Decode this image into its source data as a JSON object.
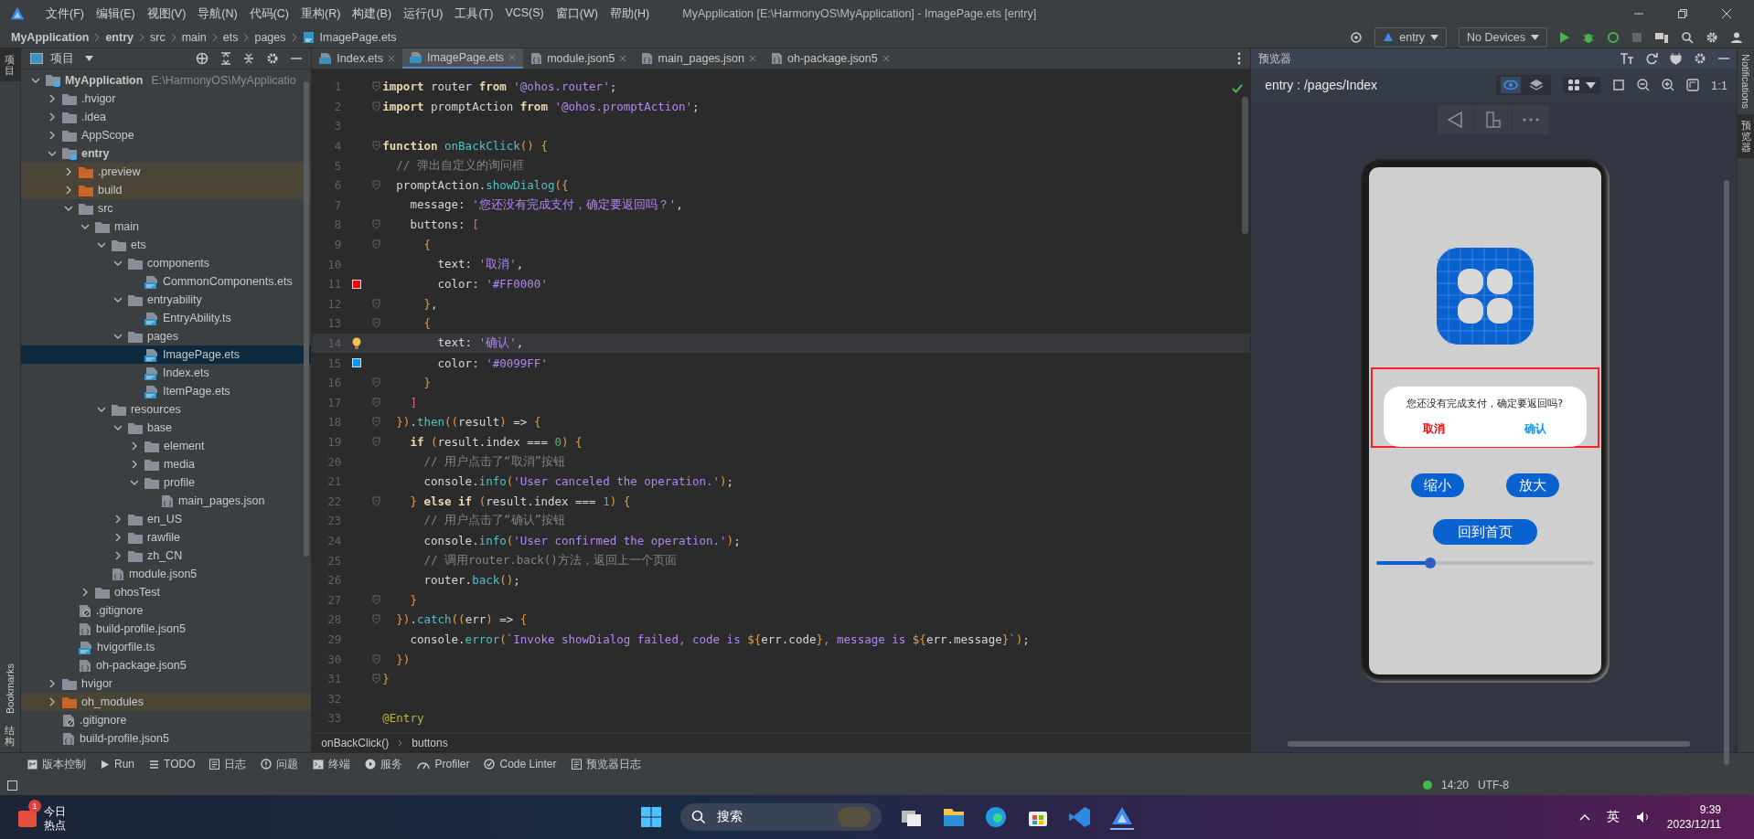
{
  "window": {
    "title": "MyApplication [E:\\HarmonyOS\\MyApplication] - ImagePage.ets [entry]",
    "menu": [
      "文件(F)",
      "编辑(E)",
      "视图(V)",
      "导航(N)",
      "代码(C)",
      "重构(R)",
      "构建(B)",
      "运行(U)",
      "工具(T)",
      "VCS(S)",
      "窗口(W)",
      "帮助(H)"
    ]
  },
  "navbar": {
    "breadcrumb": [
      "MyApplication",
      "entry",
      "src",
      "main",
      "ets",
      "pages",
      "ImagePage.ets"
    ],
    "run_config": "entry",
    "device": "No Devices"
  },
  "left_strip": [
    {
      "label": "项目",
      "selected": true
    },
    {
      "label": "Bookmarks",
      "selected": false
    },
    {
      "label": "结构",
      "selected": false
    }
  ],
  "project": {
    "title": "项目",
    "tree": [
      {
        "label": "MyApplication",
        "kind": "module",
        "hint": "E:\\HarmonyOS\\MyApplicatio",
        "expanded": true,
        "selected": false,
        "excluded": false,
        "children": [
          {
            "label": ".hvigor",
            "kind": "folder",
            "expanded": false,
            "selected": false,
            "excluded": false
          },
          {
            "label": ".idea",
            "kind": "folder",
            "expanded": false,
            "selected": false,
            "excluded": false
          },
          {
            "label": "AppScope",
            "kind": "folder",
            "expanded": false,
            "selected": false,
            "excluded": false
          },
          {
            "label": "entry",
            "kind": "module",
            "expanded": true,
            "selected": false,
            "excluded": false,
            "children": [
              {
                "label": ".preview",
                "kind": "folder",
                "expanded": false,
                "selected": false,
                "excluded": true
              },
              {
                "label": "build",
                "kind": "folder",
                "expanded": false,
                "selected": false,
                "excluded": true
              },
              {
                "label": "src",
                "kind": "folder",
                "expanded": true,
                "selected": false,
                "excluded": false,
                "children": [
                  {
                    "label": "main",
                    "kind": "folder",
                    "expanded": true,
                    "selected": false,
                    "excluded": false,
                    "children": [
                      {
                        "label": "ets",
                        "kind": "folder",
                        "expanded": true,
                        "selected": false,
                        "excluded": false,
                        "children": [
                          {
                            "label": "components",
                            "kind": "folder",
                            "expanded": true,
                            "selected": false,
                            "excluded": false,
                            "children": [
                              {
                                "label": "CommonComponents.ets",
                                "kind": "ets",
                                "selected": false,
                                "excluded": false
                              }
                            ]
                          },
                          {
                            "label": "entryability",
                            "kind": "folder",
                            "expanded": true,
                            "selected": false,
                            "excluded": false,
                            "children": [
                              {
                                "label": "EntryAbility.ts",
                                "kind": "ts",
                                "selected": false,
                                "excluded": false
                              }
                            ]
                          },
                          {
                            "label": "pages",
                            "kind": "folder",
                            "expanded": true,
                            "selected": false,
                            "excluded": false,
                            "children": [
                              {
                                "label": "ImagePage.ets",
                                "kind": "ets",
                                "selected": true,
                                "excluded": false
                              },
                              {
                                "label": "Index.ets",
                                "kind": "ets",
                                "selected": false,
                                "excluded": false
                              },
                              {
                                "label": "ItemPage.ets",
                                "kind": "ets",
                                "selected": false,
                                "excluded": false
                              }
                            ]
                          }
                        ]
                      },
                      {
                        "label": "resources",
                        "kind": "folder",
                        "expanded": true,
                        "selected": false,
                        "excluded": false,
                        "children": [
                          {
                            "label": "base",
                            "kind": "folder",
                            "expanded": true,
                            "selected": false,
                            "excluded": false,
                            "children": [
                              {
                                "label": "element",
                                "kind": "folder",
                                "expanded": false,
                                "selected": false,
                                "excluded": false
                              },
                              {
                                "label": "media",
                                "kind": "folder",
                                "expanded": false,
                                "selected": false,
                                "excluded": false
                              },
                              {
                                "label": "profile",
                                "kind": "folder",
                                "expanded": true,
                                "selected": false,
                                "excluded": false,
                                "children": [
                                  {
                                    "label": "main_pages.json",
                                    "kind": "json",
                                    "selected": false,
                                    "excluded": false
                                  }
                                ]
                              }
                            ]
                          },
                          {
                            "label": "en_US",
                            "kind": "folder",
                            "expanded": false,
                            "selected": false,
                            "excluded": false
                          },
                          {
                            "label": "rawfile",
                            "kind": "folder",
                            "expanded": false,
                            "selected": false,
                            "excluded": false
                          },
                          {
                            "label": "zh_CN",
                            "kind": "folder",
                            "expanded": false,
                            "selected": false,
                            "excluded": false
                          }
                        ]
                      },
                      {
                        "label": "module.json5",
                        "kind": "json",
                        "selected": false,
                        "excluded": false
                      }
                    ]
                  },
                  {
                    "label": "ohosTest",
                    "kind": "folder",
                    "expanded": false,
                    "selected": false,
                    "excluded": false
                  }
                ]
              },
              {
                "label": ".gitignore",
                "kind": "ignore",
                "selected": false,
                "excluded": false
              },
              {
                "label": "build-profile.json5",
                "kind": "json",
                "selected": false,
                "excluded": false
              },
              {
                "label": "hvigorfile.ts",
                "kind": "ts",
                "selected": false,
                "excluded": false
              },
              {
                "label": "oh-package.json5",
                "kind": "json",
                "selected": false,
                "excluded": false
              }
            ]
          },
          {
            "label": "hvigor",
            "kind": "folder",
            "expanded": false,
            "selected": false,
            "excluded": false
          },
          {
            "label": "oh_modules",
            "kind": "folder",
            "expanded": false,
            "selected": false,
            "excluded": true
          },
          {
            "label": ".gitignore",
            "kind": "ignore",
            "selected": false,
            "excluded": false
          },
          {
            "label": "build-profile.json5",
            "kind": "json",
            "selected": false,
            "excluded": false
          }
        ]
      }
    ]
  },
  "editor": {
    "tabs": [
      {
        "label": "Index.ets",
        "kind": "ets",
        "selected": false
      },
      {
        "label": "ImagePage.ets",
        "kind": "ets",
        "selected": true
      },
      {
        "label": "module.json5",
        "kind": "json",
        "selected": false
      },
      {
        "label": "main_pages.json",
        "kind": "json",
        "selected": false
      },
      {
        "label": "oh-package.json5",
        "kind": "json",
        "selected": false
      }
    ],
    "lines": [
      {
        "number": "1",
        "fold": true,
        "segments": [
          {
            "kind": "keyword",
            "text": "import"
          },
          {
            "kind": "plain",
            "text": " router "
          },
          {
            "kind": "keyword",
            "text": "from"
          },
          {
            "kind": "string",
            "text": " '@ohos.router'"
          },
          {
            "kind": "plain",
            "text": ";"
          }
        ]
      },
      {
        "number": "2",
        "fold": true,
        "segments": [
          {
            "kind": "keyword",
            "text": "import"
          },
          {
            "kind": "plain",
            "text": " promptAction "
          },
          {
            "kind": "keyword",
            "text": "from"
          },
          {
            "kind": "string",
            "text": " '@ohos.promptAction'"
          },
          {
            "kind": "plain",
            "text": ";"
          }
        ]
      },
      {
        "number": "3",
        "fold": false
      },
      {
        "number": "4",
        "fold": true,
        "segments": [
          {
            "kind": "keyword",
            "text": "function"
          },
          {
            "kind": "function",
            "text": " onBackClick"
          },
          {
            "kind": "brace",
            "text": "() {"
          }
        ]
      },
      {
        "number": "5",
        "fold": false,
        "segments": [
          {
            "kind": "comment",
            "text": "  // 弹出自定义的询问框"
          }
        ]
      },
      {
        "number": "6",
        "fold": true,
        "segments": [
          {
            "kind": "plain",
            "text": "  promptAction."
          },
          {
            "kind": "function",
            "text": "showDialog"
          },
          {
            "kind": "brace",
            "text": "({"
          }
        ]
      },
      {
        "number": "7",
        "fold": false,
        "segments": [
          {
            "kind": "plain",
            "text": "    message: "
          },
          {
            "kind": "string",
            "text": "'您还没有完成支付，确定要返回吗？'"
          },
          {
            "kind": "plain",
            "text": ","
          }
        ]
      },
      {
        "number": "8",
        "fold": true,
        "segments": [
          {
            "kind": "plain",
            "text": "    buttons: "
          },
          {
            "kind": "bracket",
            "text": "["
          }
        ]
      },
      {
        "number": "9",
        "fold": true,
        "segments": [
          {
            "kind": "brace",
            "text": "      {"
          }
        ]
      },
      {
        "number": "10",
        "fold": false,
        "segments": [
          {
            "kind": "plain",
            "text": "        text: "
          },
          {
            "kind": "string",
            "text": "'取消'"
          },
          {
            "kind": "plain",
            "text": ","
          }
        ]
      },
      {
        "number": "11",
        "fold": false,
        "color": "#ff0000",
        "segments": [
          {
            "kind": "plain",
            "text": "        color: "
          },
          {
            "kind": "string",
            "text": "'#FF0000'"
          }
        ]
      },
      {
        "number": "12",
        "fold": true,
        "segments": [
          {
            "kind": "brace",
            "text": "      }"
          },
          {
            "kind": "plain",
            "text": ","
          }
        ]
      },
      {
        "number": "13",
        "fold": true,
        "segments": [
          {
            "kind": "brace",
            "text": "      {"
          }
        ]
      },
      {
        "number": "14",
        "fold": false,
        "current": true,
        "bulb": true,
        "segments": [
          {
            "kind": "plain",
            "text": "        text: "
          },
          {
            "kind": "string",
            "text": "'确认'"
          },
          {
            "kind": "plain",
            "text": ","
          }
        ]
      },
      {
        "number": "15",
        "fold": false,
        "color": "#0099ff",
        "segments": [
          {
            "kind": "plain",
            "text": "        color: "
          },
          {
            "kind": "string",
            "text": "'#0099FF'"
          }
        ]
      },
      {
        "number": "16",
        "fold": true,
        "segments": [
          {
            "kind": "brace",
            "text": "      }"
          }
        ]
      },
      {
        "number": "17",
        "fold": true,
        "segments": [
          {
            "kind": "bracket",
            "text": "    ]"
          }
        ]
      },
      {
        "number": "18",
        "fold": true,
        "segments": [
          {
            "kind": "brace",
            "text": "  })"
          },
          {
            "kind": "plain",
            "text": "."
          },
          {
            "kind": "function",
            "text": "then"
          },
          {
            "kind": "brace",
            "text": "(("
          },
          {
            "kind": "plain",
            "text": "result"
          },
          {
            "kind": "brace",
            "text": ")"
          },
          {
            "kind": "plain",
            "text": " => "
          },
          {
            "kind": "brace",
            "text": "{"
          }
        ]
      },
      {
        "number": "19",
        "fold": true,
        "segments": [
          {
            "kind": "keyword",
            "text": "    if"
          },
          {
            "kind": "brace",
            "text": " ("
          },
          {
            "kind": "plain",
            "text": "result.index === "
          },
          {
            "kind": "number",
            "text": "0"
          },
          {
            "kind": "brace",
            "text": ") {"
          }
        ]
      },
      {
        "number": "20",
        "fold": false,
        "segments": [
          {
            "kind": "comment",
            "text": "      // 用户点击了“取消”按钮"
          }
        ]
      },
      {
        "number": "21",
        "fold": false,
        "segments": [
          {
            "kind": "plain",
            "text": "      console."
          },
          {
            "kind": "function",
            "text": "info"
          },
          {
            "kind": "brace",
            "text": "("
          },
          {
            "kind": "string",
            "text": "'User canceled the operation.'"
          },
          {
            "kind": "brace",
            "text": ")"
          },
          {
            "kind": "plain",
            "text": ";"
          }
        ]
      },
      {
        "number": "22",
        "fold": true,
        "segments": [
          {
            "kind": "brace",
            "text": "    }"
          },
          {
            "kind": "keyword",
            "text": " else if"
          },
          {
            "kind": "brace",
            "text": " ("
          },
          {
            "kind": "plain",
            "text": "result.index === "
          },
          {
            "kind": "number",
            "text": "1"
          },
          {
            "kind": "brace",
            "text": ") {"
          }
        ]
      },
      {
        "number": "23",
        "fold": false,
        "segments": [
          {
            "kind": "comment",
            "text": "      // 用户点击了“确认”按钮"
          }
        ]
      },
      {
        "number": "24",
        "fold": false,
        "segments": [
          {
            "kind": "plain",
            "text": "      console."
          },
          {
            "kind": "function",
            "text": "info"
          },
          {
            "kind": "brace",
            "text": "("
          },
          {
            "kind": "string",
            "text": "'User confirmed the operation.'"
          },
          {
            "kind": "brace",
            "text": ")"
          },
          {
            "kind": "plain",
            "text": ";"
          }
        ]
      },
      {
        "number": "25",
        "fold": false,
        "segments": [
          {
            "kind": "comment",
            "text": "      // 调用router.back()方法，返回上一个页面"
          }
        ]
      },
      {
        "number": "26",
        "fold": false,
        "segments": [
          {
            "kind": "plain",
            "text": "      router."
          },
          {
            "kind": "function",
            "text": "back"
          },
          {
            "kind": "brace",
            "text": "()"
          },
          {
            "kind": "plain",
            "text": ";"
          }
        ]
      },
      {
        "number": "27",
        "fold": true,
        "segments": [
          {
            "kind": "brace",
            "text": "    }"
          }
        ]
      },
      {
        "number": "28",
        "fold": true,
        "segments": [
          {
            "kind": "brace",
            "text": "  })"
          },
          {
            "kind": "plain",
            "text": "."
          },
          {
            "kind": "function",
            "text": "catch"
          },
          {
            "kind": "brace",
            "text": "(("
          },
          {
            "kind": "plain",
            "text": "err"
          },
          {
            "kind": "brace",
            "text": ")"
          },
          {
            "kind": "plain",
            "text": " => "
          },
          {
            "kind": "brace",
            "text": "{"
          }
        ]
      },
      {
        "number": "29",
        "fold": false,
        "segments": [
          {
            "kind": "plain",
            "text": "    console."
          },
          {
            "kind": "function",
            "text": "error"
          },
          {
            "kind": "brace",
            "text": "("
          },
          {
            "kind": "string",
            "text": "`Invoke showDialog failed, code is "
          },
          {
            "kind": "brace",
            "text": "${"
          },
          {
            "kind": "plain",
            "text": "err.code"
          },
          {
            "kind": "brace",
            "text": "}"
          },
          {
            "kind": "string",
            "text": ", message is "
          },
          {
            "kind": "brace",
            "text": "${"
          },
          {
            "kind": "plain",
            "text": "err.message"
          },
          {
            "kind": "brace",
            "text": "}"
          },
          {
            "kind": "string",
            "text": "`"
          },
          {
            "kind": "brace",
            "text": ")"
          },
          {
            "kind": "plain",
            "text": ";"
          }
        ]
      },
      {
        "number": "30",
        "fold": true,
        "segments": [
          {
            "kind": "brace",
            "text": "  })"
          }
        ]
      },
      {
        "number": "31",
        "fold": true,
        "segments": [
          {
            "kind": "brace",
            "text": "}"
          }
        ]
      },
      {
        "number": "32",
        "fold": false
      },
      {
        "number": "33",
        "fold": false,
        "segments": [
          {
            "kind": "annotation",
            "text": "@Entry"
          }
        ]
      }
    ],
    "breadcrumb": [
      "onBackClick()",
      "buttons"
    ]
  },
  "preview": {
    "title": "预览器",
    "route": "entry : /pages/Index",
    "zoom_label": "1:1",
    "dialog": {
      "message": "您还没有完成支付，确定要返回吗?",
      "buttons": [
        {
          "label": "取消",
          "color": "#ff0000"
        },
        {
          "label": "确认",
          "color": "#0099ff"
        }
      ]
    },
    "buttons": [
      "缩小",
      "放大"
    ],
    "home_button": "回到首页",
    "slider": {
      "level": 0.25
    }
  },
  "right_strip": [
    {
      "label": "Notifications",
      "selected": false
    },
    {
      "label": "预览器",
      "selected": true
    }
  ],
  "tool_windows": [
    {
      "label": "版本控制",
      "kind": "vcs"
    },
    {
      "label": "Run",
      "kind": "run"
    },
    {
      "label": "TODO",
      "kind": "todo"
    },
    {
      "label": "日志",
      "kind": "log"
    },
    {
      "label": "问题",
      "kind": "problems"
    },
    {
      "label": "终端",
      "kind": "terminal"
    },
    {
      "label": "服务",
      "kind": "services"
    },
    {
      "label": "Profiler",
      "kind": "profiler"
    },
    {
      "label": "Code Linter",
      "kind": "linter"
    },
    {
      "label": "预览器日志",
      "kind": "log"
    }
  ],
  "status_bar": {
    "position": "14:20",
    "encoding": "UTF-8"
  },
  "taskbar": {
    "widget": {
      "badge": "1",
      "title": "今日",
      "subtitle": "热点"
    },
    "search": "搜索",
    "language": "英",
    "time": "9:39",
    "date": "2023/12/11"
  }
}
